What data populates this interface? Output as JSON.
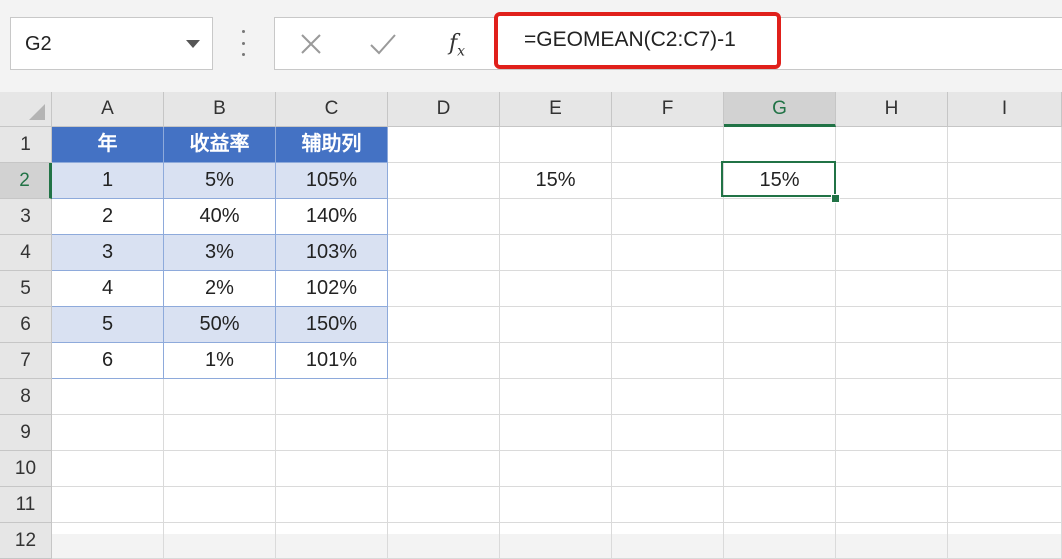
{
  "name_box": {
    "value": "G2"
  },
  "formula_bar": {
    "formula": "=GEOMEAN(C2:C7)-1"
  },
  "colors": {
    "table_header": "#4472c4",
    "table_band": "#d9e1f2",
    "selection": "#217346",
    "highlight_border": "#e0201b"
  },
  "columns": [
    "A",
    "B",
    "C",
    "D",
    "E",
    "F",
    "G",
    "H",
    "I"
  ],
  "rows": [
    "1",
    "2",
    "3",
    "4",
    "5",
    "6",
    "7",
    "8",
    "9",
    "10",
    "11",
    "12"
  ],
  "table": {
    "headers": [
      "年",
      "收益率",
      "辅助列"
    ],
    "rows": [
      [
        "1",
        "5%",
        "105%"
      ],
      [
        "2",
        "40%",
        "140%"
      ],
      [
        "3",
        "3%",
        "103%"
      ],
      [
        "4",
        "2%",
        "102%"
      ],
      [
        "5",
        "50%",
        "150%"
      ],
      [
        "6",
        "1%",
        "101%"
      ]
    ]
  },
  "cells": {
    "E2": "15%",
    "G2": "15%"
  },
  "active_cell": "G2"
}
